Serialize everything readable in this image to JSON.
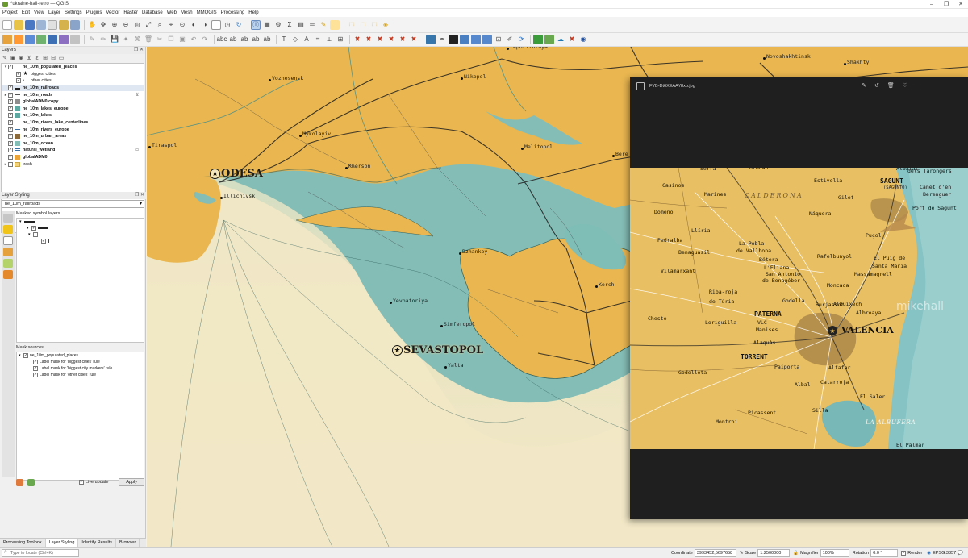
{
  "window": {
    "title": "*ukraine-hall-retro — QGIS"
  },
  "menu": [
    "Project",
    "Edit",
    "View",
    "Layer",
    "Settings",
    "Plugins",
    "Vector",
    "Raster",
    "Database",
    "Web",
    "Mesh",
    "MMQGIS",
    "Processing",
    "Help"
  ],
  "layers_panel": {
    "title": "Layers",
    "items": [
      {
        "label": "ne_10m_populated_places",
        "bold": true,
        "checked": true,
        "expander": "▾",
        "indent": 0,
        "symbol": "none"
      },
      {
        "label": "biggest cities",
        "bold": false,
        "checked": true,
        "expander": "",
        "indent": 1,
        "symbol": "star"
      },
      {
        "label": "other cities",
        "bold": false,
        "checked": true,
        "expander": "",
        "indent": 1,
        "symbol": "dot"
      },
      {
        "label": "ne_10m_railroads",
        "bold": true,
        "checked": true,
        "expander": "",
        "indent": 0,
        "symbol": "rail",
        "selected": true
      },
      {
        "label": "ne_10m_roads",
        "bold": true,
        "checked": true,
        "expander": "▸",
        "indent": 0,
        "symbol": "road"
      },
      {
        "label": "globalADM0 copy",
        "bold": true,
        "checked": true,
        "expander": "",
        "indent": 0,
        "symbol": "grey"
      },
      {
        "label": "ne_10m_lakes_europe",
        "bold": true,
        "checked": true,
        "expander": "",
        "indent": 0,
        "symbol": "teal"
      },
      {
        "label": "ne_10m_lakes",
        "bold": true,
        "checked": true,
        "expander": "",
        "indent": 0,
        "symbol": "teal"
      },
      {
        "label": "ne_10m_rivers_lake_centerlines",
        "bold": true,
        "checked": true,
        "expander": "",
        "indent": 0,
        "symbol": "line"
      },
      {
        "label": "ne_10m_rivers_europe",
        "bold": true,
        "checked": true,
        "expander": "",
        "indent": 0,
        "symbol": "line"
      },
      {
        "label": "ne_10m_urban_areas",
        "bold": true,
        "checked": true,
        "expander": "",
        "indent": 0,
        "symbol": "brown"
      },
      {
        "label": "ne_10m_ocean",
        "bold": true,
        "checked": true,
        "expander": "",
        "indent": 0,
        "symbol": "ocean"
      },
      {
        "label": "natural_wetland",
        "bold": true,
        "checked": true,
        "expander": "",
        "indent": 0,
        "symbol": "wet"
      },
      {
        "label": "globalADM0",
        "bold": true,
        "checked": true,
        "expander": "",
        "indent": 0,
        "symbol": "orange"
      },
      {
        "label": "trash",
        "bold": false,
        "checked": false,
        "expander": "▸",
        "indent": 0,
        "symbol": "folder"
      }
    ]
  },
  "styling_panel": {
    "title": "Layer Styling",
    "selected_layer": "ne_10m_railroads",
    "masked_label": "Masked symbol layers",
    "mask_sources_label": "Mask sources",
    "mask_sources": [
      {
        "label": "ne_10m_populated_places",
        "level": 0
      },
      {
        "label": "Label mask for 'biggest cities' rule",
        "level": 1
      },
      {
        "label": "Label mask for 'biggest city markers' rule",
        "level": 1
      },
      {
        "label": "Label mask for 'other cities' rule",
        "level": 1
      }
    ],
    "live_update": "Live update",
    "apply": "Apply"
  },
  "bottom_tabs": [
    "Processing Toolbox",
    "Layer Styling",
    "Identify Results",
    "Browser"
  ],
  "map": {
    "cities": [
      {
        "name": "ODESA",
        "major": true
      },
      {
        "name": "SEVASTOPOL",
        "major": true
      },
      {
        "name": "Illichivsk",
        "major": false
      },
      {
        "name": "Voznesensk",
        "major": false
      },
      {
        "name": "Nikopol",
        "major": false
      },
      {
        "name": "Zaporizhzhya",
        "major": false
      },
      {
        "name": "Novoshakhtinsk",
        "major": false
      },
      {
        "name": "Shakhty",
        "major": false
      },
      {
        "name": "Tiraspol",
        "major": false
      },
      {
        "name": "Mykolayiv",
        "major": false
      },
      {
        "name": "Kherson",
        "major": false
      },
      {
        "name": "Melitopol",
        "major": false
      },
      {
        "name": "Dzhankoy",
        "major": false
      },
      {
        "name": "Yevpatoriya",
        "major": false
      },
      {
        "name": "Simferopol",
        "major": false
      },
      {
        "name": "Yalta",
        "major": false
      },
      {
        "name": "Kerch",
        "major": false
      },
      {
        "name": "Bere",
        "major": false
      }
    ]
  },
  "photo_viewer": {
    "filename": "FYB-Dt6XEAAY8xp.jpg",
    "watermark": "mikehall",
    "places": [
      {
        "name": "VALENCIA",
        "style": "major"
      },
      {
        "name": "SAGUNT",
        "style": "bold"
      },
      {
        "name": "(SAGUNTO)",
        "style": "small"
      },
      {
        "name": "Port de Sagunt",
        "style": "normal"
      },
      {
        "name": "Canet d'en",
        "style": "normal"
      },
      {
        "name": "Berenguer",
        "style": "normal"
      },
      {
        "name": "El Puig de",
        "style": "normal"
      },
      {
        "name": "Santa Maria",
        "style": "normal"
      },
      {
        "name": "Puçol",
        "style": "normal"
      },
      {
        "name": "Massamagrell",
        "style": "normal"
      },
      {
        "name": "Rafelbunyol",
        "style": "normal"
      },
      {
        "name": "Moncada",
        "style": "normal"
      },
      {
        "name": "Burjassot",
        "style": "normal"
      },
      {
        "name": "Albroaya",
        "style": "normal"
      },
      {
        "name": "PATERNA",
        "style": "bold"
      },
      {
        "name": "Manises",
        "style": "normal"
      },
      {
        "name": "VLC",
        "style": "normal"
      },
      {
        "name": "TORRENT",
        "style": "bold"
      },
      {
        "name": "Paiporta",
        "style": "normal"
      },
      {
        "name": "Alfafar",
        "style": "normal"
      },
      {
        "name": "Catarroja",
        "style": "normal"
      },
      {
        "name": "Albal",
        "style": "normal"
      },
      {
        "name": "Silla",
        "style": "normal"
      },
      {
        "name": "El Saler",
        "style": "normal"
      },
      {
        "name": "LA ALBUFERA",
        "style": "water"
      },
      {
        "name": "Picassent",
        "style": "normal"
      },
      {
        "name": "Montroi",
        "style": "normal"
      },
      {
        "name": "Godelleta",
        "style": "normal"
      },
      {
        "name": "Cheste",
        "style": "normal"
      },
      {
        "name": "Loriguilla",
        "style": "normal"
      },
      {
        "name": "Riba-roja",
        "style": "normal"
      },
      {
        "name": "de Túria",
        "style": "normal"
      },
      {
        "name": "Vilamarxant",
        "style": "normal"
      },
      {
        "name": "Benaguasil",
        "style": "normal"
      },
      {
        "name": "La Pobla",
        "style": "normal"
      },
      {
        "name": "de Vallbona",
        "style": "normal"
      },
      {
        "name": "Bétera",
        "style": "normal"
      },
      {
        "name": "L'Eliana",
        "style": "normal"
      },
      {
        "name": "San Antonio",
        "style": "normal"
      },
      {
        "name": "de Benagéber",
        "style": "normal"
      },
      {
        "name": "Llíria",
        "style": "normal"
      },
      {
        "name": "Pedralba",
        "style": "normal"
      },
      {
        "name": "Domeño",
        "style": "normal"
      },
      {
        "name": "Casinos",
        "style": "normal"
      },
      {
        "name": "Marines",
        "style": "normal"
      },
      {
        "name": "Olocau",
        "style": "normal"
      },
      {
        "name": "Estivella",
        "style": "normal"
      },
      {
        "name": "Gilet",
        "style": "normal"
      },
      {
        "name": "Náquera",
        "style": "normal"
      },
      {
        "name": "Serra",
        "style": "normal"
      },
      {
        "name": "CALDERONA",
        "style": "region"
      },
      {
        "name": "Albalat",
        "style": "normal"
      },
      {
        "name": "dels Tarongers",
        "style": "normal"
      },
      {
        "name": "Albuixech",
        "style": "normal"
      },
      {
        "name": "Godella",
        "style": "normal"
      },
      {
        "name": "Alaquàs",
        "style": "normal"
      },
      {
        "name": "El Palmar",
        "style": "normal"
      }
    ]
  },
  "statusbar": {
    "locate_placeholder": "Type to locate (Ctrl+K)",
    "coordinate_label": "Coordinate",
    "coordinate": "3993452,5697658",
    "scale_label": "Scale",
    "scale": "1:2500000",
    "magnifier_label": "Magnifier",
    "magnifier": "100%",
    "rotation_label": "Rotation",
    "rotation": "0.0 °",
    "render_label": "Render",
    "crs": "EPSG:3857"
  },
  "colors": {
    "land": "#e9b650",
    "sea": "#7fbdb7",
    "deep_sea": "#6ea9a3",
    "paper": "#f2e8c6"
  }
}
